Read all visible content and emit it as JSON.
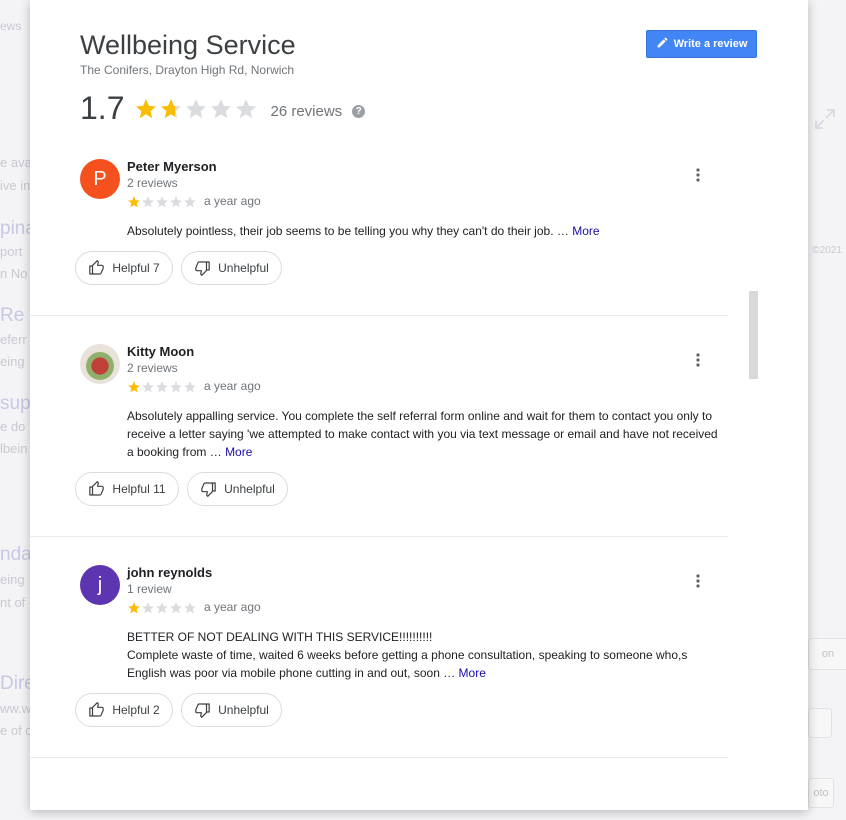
{
  "background": {
    "frags_left": [
      "ews",
      "e ava",
      "ive in",
      "pina",
      "port",
      "n No",
      "Re",
      "eferr",
      "eing",
      "sup",
      "e do",
      "lbein",
      "nda",
      "eing",
      "nt of",
      "Dire",
      "ww.w",
      "e of c"
    ],
    "copyright": "©2021",
    "btn1": "on",
    "btn2": "oto"
  },
  "place": {
    "title": "Wellbeing Service",
    "address": "The Conifers, Drayton High Rd, Norwich",
    "rating": "1.7",
    "rating_value": 1.7,
    "review_count": "26 reviews",
    "write_review_label": "Write a review"
  },
  "colors": {
    "star_filled": "#fbbc04",
    "star_empty": "#dadce0",
    "button_blue": "#4285f4",
    "link": "#1a0dab"
  },
  "reviews": [
    {
      "initial": "P",
      "avatar_color": "#f4511e",
      "name": "Peter Myerson",
      "count": "2 reviews",
      "stars": 1,
      "time": "a year ago",
      "text": "Absolutely pointless, their job seems to be telling you why they can't do their job.",
      "ellipsis": " … ",
      "more": "More",
      "helpful": "Helpful 7",
      "unhelpful": "Unhelpful"
    },
    {
      "initial": "",
      "avatar_color": "#c74b3f",
      "name": "Kitty Moon",
      "count": "2 reviews",
      "stars": 1,
      "time": "a year ago",
      "text": "Absolutely appalling service.  You complete the self referral form online and wait for them to contact you only to receive a letter saying 'we attempted to make contact with you via text message or email and have not received a booking from",
      "ellipsis": " … ",
      "more": "More",
      "helpful": "Helpful 11",
      "unhelpful": "Unhelpful"
    },
    {
      "initial": "j",
      "avatar_color": "#5e35b1",
      "name": "john reynolds",
      "count": "1 review",
      "stars": 1,
      "time": "a year ago",
      "text_line1": "BETTER OF NOT DEALING WITH THIS SERVICE!!!!!!!!!!",
      "text": "Complete waste of time, waited 6 weeks before getting a phone consultation, speaking to someone who,s English was poor via mobile phone cutting in and out, soon",
      "ellipsis": " … ",
      "more": "More",
      "helpful": "Helpful 2",
      "unhelpful": "Unhelpful"
    }
  ],
  "icons": {
    "pencil": "pencil-icon",
    "help": "help-icon",
    "more": "more-vert-icon",
    "thumbs_up": "thumbs-up-icon",
    "thumbs_down": "thumbs-down-icon",
    "expand": "expand-icon"
  }
}
